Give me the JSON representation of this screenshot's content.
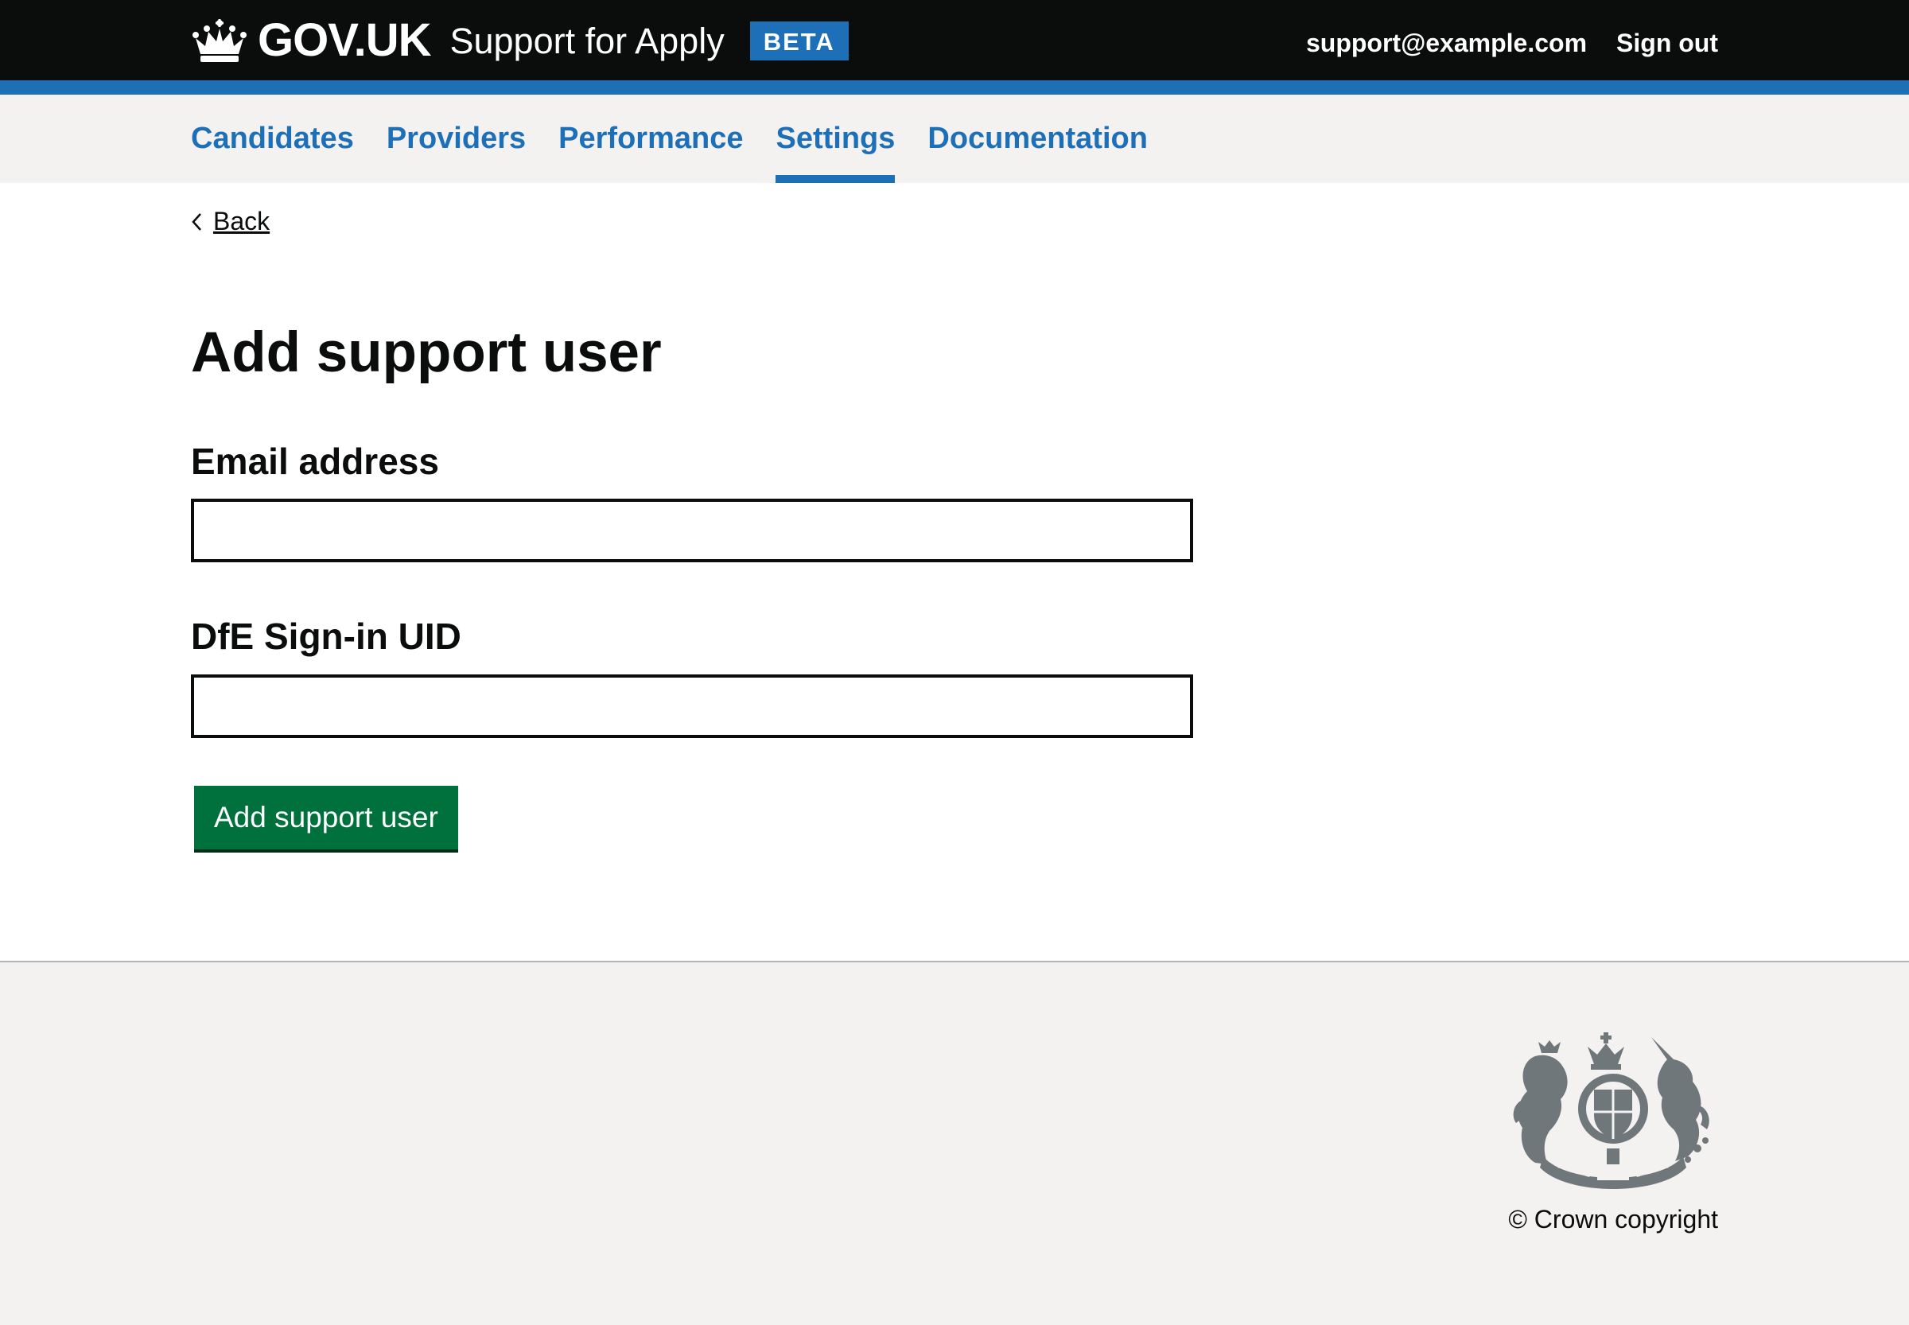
{
  "header": {
    "logo_text": "GOV.UK",
    "service_name": "Support for Apply",
    "phase_tag": "BETA",
    "user_email": "support@example.com",
    "sign_out_label": "Sign out"
  },
  "nav": {
    "items": [
      {
        "label": "Candidates",
        "active": false
      },
      {
        "label": "Providers",
        "active": false
      },
      {
        "label": "Performance",
        "active": false
      },
      {
        "label": "Settings",
        "active": true
      },
      {
        "label": "Documentation",
        "active": false
      }
    ]
  },
  "back_link": {
    "label": "Back",
    "icon": "chevron-left-icon"
  },
  "main": {
    "title": "Add support user",
    "form": {
      "email": {
        "label": "Email address",
        "value": "",
        "placeholder": ""
      },
      "dfe_uid": {
        "label": "DfE Sign-in UID",
        "value": "",
        "placeholder": ""
      },
      "submit_label": "Add support user"
    }
  },
  "footer": {
    "crest_icon": "royal-coat-of-arms-icon",
    "copyright": "© Crown copyright"
  },
  "colors": {
    "header_background": "#0b0c0c",
    "brand_blue": "#1d70b8",
    "nav_background": "#f3f2f1",
    "button_green": "#00703c",
    "footer_background": "#f3f2f1",
    "crest_grey": "#6f777b"
  }
}
